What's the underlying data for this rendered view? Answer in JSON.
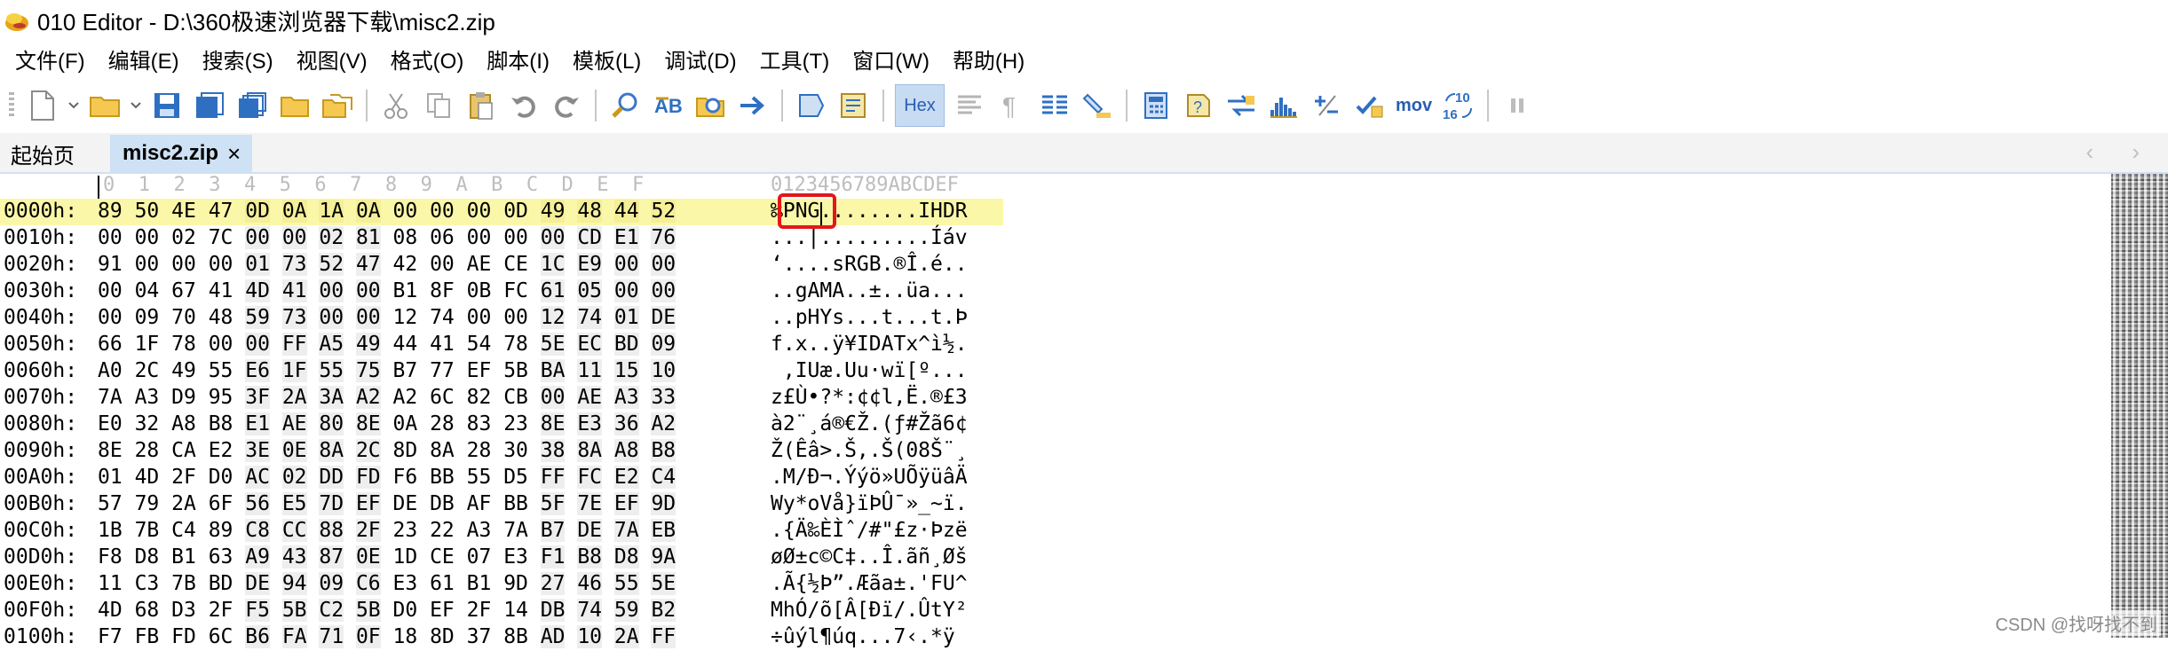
{
  "window": {
    "title": "010 Editor - D:\\360极速浏览器下载\\misc2.zip"
  },
  "menu": [
    "文件(F)",
    "编辑(E)",
    "搜索(S)",
    "视图(V)",
    "格式(O)",
    "脚本(I)",
    "模板(L)",
    "调试(D)",
    "工具(T)",
    "窗口(W)",
    "帮助(H)"
  ],
  "toolbar": {
    "hex_label": "Hex",
    "mov_label": "mov",
    "icon_1016": "1016"
  },
  "tabs": {
    "home": "起始页",
    "active": "misc2.zip",
    "close": "×",
    "arrows": "‹ ›"
  },
  "hex": {
    "column_header_hex": "0  1  2  3  4  5  6  7  8  9  A  B  C  D  E  F",
    "column_header_ascii": "0123456789ABCDEF",
    "rows": [
      {
        "addr": "0000h:",
        "bytes": [
          "89",
          "50",
          "4E",
          "47",
          "0D",
          "0A",
          "1A",
          "0A",
          "00",
          "00",
          "00",
          "0D",
          "49",
          "48",
          "44",
          "52"
        ],
        "ascii": "‰PNG........IHDR"
      },
      {
        "addr": "0010h:",
        "bytes": [
          "00",
          "00",
          "02",
          "7C",
          "00",
          "00",
          "02",
          "81",
          "08",
          "06",
          "00",
          "00",
          "00",
          "CD",
          "E1",
          "76"
        ],
        "ascii": "...|.........Íáv"
      },
      {
        "addr": "0020h:",
        "bytes": [
          "91",
          "00",
          "00",
          "00",
          "01",
          "73",
          "52",
          "47",
          "42",
          "00",
          "AE",
          "CE",
          "1C",
          "E9",
          "00",
          "00"
        ],
        "ascii": "‘....sRGB.®Î.é.."
      },
      {
        "addr": "0030h:",
        "bytes": [
          "00",
          "04",
          "67",
          "41",
          "4D",
          "41",
          "00",
          "00",
          "B1",
          "8F",
          "0B",
          "FC",
          "61",
          "05",
          "00",
          "00"
        ],
        "ascii": "..gAMA..±..üa..."
      },
      {
        "addr": "0040h:",
        "bytes": [
          "00",
          "09",
          "70",
          "48",
          "59",
          "73",
          "00",
          "00",
          "12",
          "74",
          "00",
          "00",
          "12",
          "74",
          "01",
          "DE"
        ],
        "ascii": "..pHYs...t...t.Þ"
      },
      {
        "addr": "0050h:",
        "bytes": [
          "66",
          "1F",
          "78",
          "00",
          "00",
          "FF",
          "A5",
          "49",
          "44",
          "41",
          "54",
          "78",
          "5E",
          "EC",
          "BD",
          "09"
        ],
        "ascii": "f.x..ÿ¥IDATx^ì½."
      },
      {
        "addr": "0060h:",
        "bytes": [
          "A0",
          "2C",
          "49",
          "55",
          "E6",
          "1F",
          "55",
          "75",
          "B7",
          "77",
          "EF",
          "5B",
          "BA",
          "11",
          "15",
          "10"
        ],
        "ascii": " ,IUæ.Uu·wï[º..."
      },
      {
        "addr": "0070h:",
        "bytes": [
          "7A",
          "A3",
          "D9",
          "95",
          "3F",
          "2A",
          "3A",
          "A2",
          "A2",
          "6C",
          "82",
          "CB",
          "00",
          "AE",
          "A3",
          "33"
        ],
        "ascii": "z£Ù•?*:¢¢l‚Ë.®£3"
      },
      {
        "addr": "0080h:",
        "bytes": [
          "E0",
          "32",
          "A8",
          "B8",
          "E1",
          "AE",
          "80",
          "8E",
          "0A",
          "28",
          "83",
          "23",
          "8E",
          "E3",
          "36",
          "A2"
        ],
        "ascii": "à2¨¸á®€Ž.(ƒ#Žã6¢"
      },
      {
        "addr": "0090h:",
        "bytes": [
          "8E",
          "28",
          "CA",
          "E2",
          "3E",
          "0E",
          "8A",
          "2C",
          "8D",
          "8A",
          "28",
          "30",
          "38",
          "8A",
          "A8",
          "B8"
        ],
        "ascii": "Ž(Êâ>.Š,.Š(08Š¨¸"
      },
      {
        "addr": "00A0h:",
        "bytes": [
          "01",
          "4D",
          "2F",
          "D0",
          "AC",
          "02",
          "DD",
          "FD",
          "F6",
          "BB",
          "55",
          "D5",
          "FF",
          "FC",
          "E2",
          "C4"
        ],
        "ascii": ".M/Ð¬.Ýýö»UÕÿüâÄ"
      },
      {
        "addr": "00B0h:",
        "bytes": [
          "57",
          "79",
          "2A",
          "6F",
          "56",
          "E5",
          "7D",
          "EF",
          "DE",
          "DB",
          "AF",
          "BB",
          "5F",
          "7E",
          "EF",
          "9D"
        ],
        "ascii": "Wy*oVå}ïÞÛ¯»_~ï."
      },
      {
        "addr": "00C0h:",
        "bytes": [
          "1B",
          "7B",
          "C4",
          "89",
          "C8",
          "CC",
          "88",
          "2F",
          "23",
          "22",
          "A3",
          "7A",
          "B7",
          "DE",
          "7A",
          "EB"
        ],
        "ascii": ".{Ä‰ÈÌˆ/#\"£z·Þzë"
      },
      {
        "addr": "00D0h:",
        "bytes": [
          "F8",
          "D8",
          "B1",
          "63",
          "A9",
          "43",
          "87",
          "0E",
          "1D",
          "CE",
          "07",
          "E3",
          "F1",
          "B8",
          "D8",
          "9A"
        ],
        "ascii": "øØ±c©C‡..Î.ãñ¸Øš"
      },
      {
        "addr": "00E0h:",
        "bytes": [
          "11",
          "C3",
          "7B",
          "BD",
          "DE",
          "94",
          "09",
          "C6",
          "E3",
          "61",
          "B1",
          "9D",
          "27",
          "46",
          "55",
          "5E"
        ],
        "ascii": ".Ã{½Þ”.Æãa±.'FU^"
      },
      {
        "addr": "00F0h:",
        "bytes": [
          "4D",
          "68",
          "D3",
          "2F",
          "F5",
          "5B",
          "C2",
          "5B",
          "D0",
          "EF",
          "2F",
          "14",
          "DB",
          "74",
          "59",
          "B2"
        ],
        "ascii": "MhÓ/õ[Â[Ðï/.ÛtY²"
      },
      {
        "addr": "0100h:",
        "bytes": [
          "F7",
          "FB",
          "FD",
          "6C",
          "B6",
          "FA",
          "71",
          "0F",
          "18",
          "8D",
          "37",
          "8B",
          "AD",
          "10",
          "2A",
          "FF"
        ],
        "ascii": "÷ûýl¶úq...7‹.*ÿ"
      }
    ]
  },
  "watermark": "CSDN @找呀找不到",
  "colors": {
    "highlight_row": "#fbf7a8",
    "tab_active": "#cfe1f4",
    "red_box": "#e3161b",
    "hex_active": "#c7dcf2"
  }
}
